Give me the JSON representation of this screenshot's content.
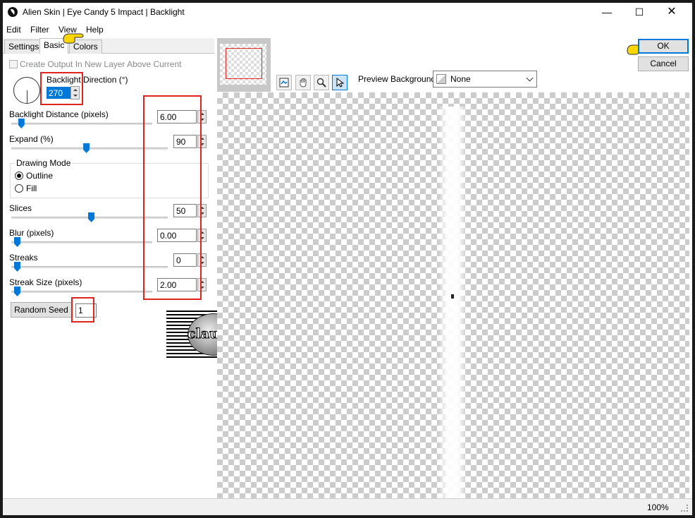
{
  "window": {
    "title": "Alien Skin | Eye Candy 5 Impact | Backlight",
    "minimize_glyph": "—",
    "maximize_glyph": "☐",
    "close_glyph": "✕"
  },
  "menu": {
    "items": [
      "Edit",
      "Filter",
      "View",
      "Help"
    ]
  },
  "tabs": [
    "Settings",
    "Basic",
    "Colors"
  ],
  "active_tab": "Basic",
  "basic": {
    "create_output_label": "Create Output In New Layer Above Current",
    "backlight_direction": {
      "label": "Backlight Direction (°)",
      "value": "270"
    },
    "backlight_distance": {
      "label": "Backlight Distance (pixels)",
      "value": "6.00",
      "slider_fraction": 0.03
    },
    "expand": {
      "label": "Expand (%)",
      "value": "90",
      "slider_fraction": 0.45
    },
    "drawing_mode": {
      "label": "Drawing Mode",
      "options": [
        "Outline",
        "Fill"
      ],
      "selected": "Outline"
    },
    "slices": {
      "label": "Slices",
      "value": "50",
      "slider_fraction": 0.5
    },
    "blur": {
      "label": "Blur (pixels)",
      "value": "0.00",
      "slider_fraction": 0.0
    },
    "streaks": {
      "label": "Streaks",
      "value": "0",
      "slider_fraction": 0.0
    },
    "streak_size": {
      "label": "Streak Size (pixels)",
      "value": "2.00",
      "slider_fraction": 0.0
    },
    "random_seed": {
      "label": "Random Seed",
      "value": "1"
    }
  },
  "buttons": {
    "ok": "OK",
    "cancel": "Cancel"
  },
  "preview_background": {
    "label": "Preview Background:",
    "value": "None"
  },
  "status": {
    "zoom": "100%"
  },
  "watermark": {
    "text": "claudia"
  },
  "colors": {
    "red_highlight": "#e0231c",
    "accent": "#0078d7"
  }
}
